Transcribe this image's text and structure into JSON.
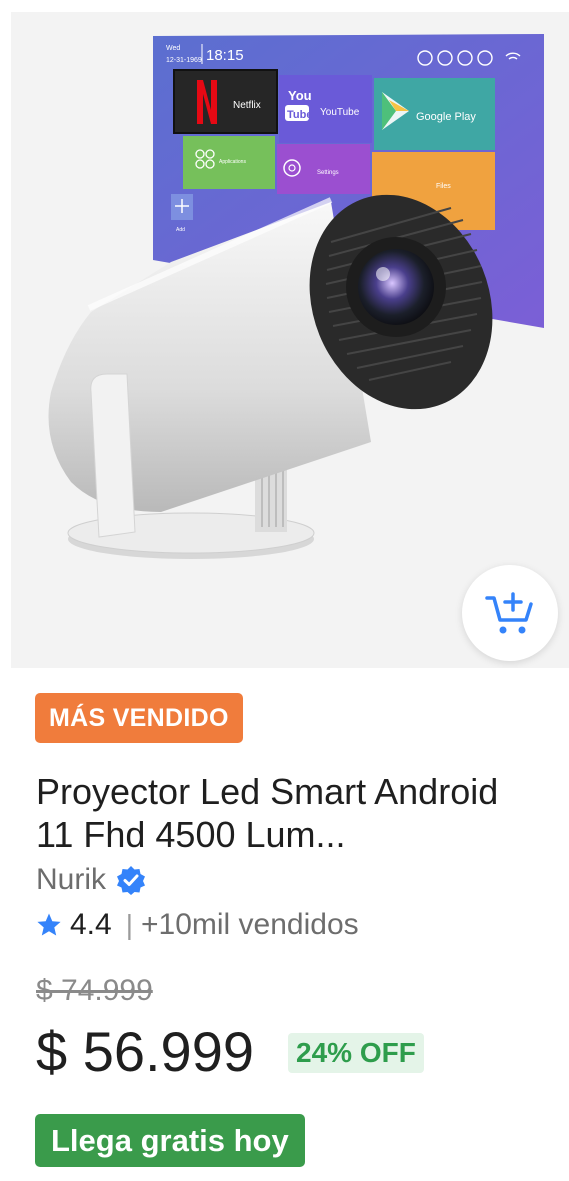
{
  "product": {
    "screen_ui": {
      "date_label": "Wed",
      "date": "12-31-1969",
      "time": "18:15",
      "tiles": [
        "Netflix",
        "YouTube",
        "Google Play",
        "Applications",
        "Settings",
        "Files",
        "Add"
      ],
      "youtube_logo_top": "You",
      "youtube_logo_bottom": "Tube"
    },
    "badge": "MÁS VENDIDO",
    "title": "Proyector Led Smart Android 11 Fhd 4500 Lum...",
    "seller": "Nurik",
    "rating": "4.4",
    "rating_separator": "|",
    "sold": "+10mil vendidos",
    "old_price": "$ 74.999",
    "price": "$ 56.999",
    "discount": "24% OFF",
    "shipping": "Llega gratis hoy"
  },
  "colors": {
    "badge_orange": "#f07c3c",
    "verified_blue": "#3483fa",
    "star_blue": "#3483fa",
    "discount_green": "#2e9d4c",
    "shipping_green": "#3a9b4b"
  },
  "icons": {
    "cart": "add-to-cart-icon",
    "verified": "verified-check-icon",
    "star": "star-icon"
  }
}
